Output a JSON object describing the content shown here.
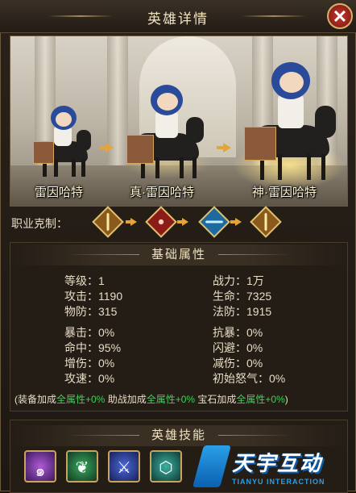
{
  "dialog": {
    "title": "英雄详情",
    "close_icon": "close-icon"
  },
  "heroes": [
    {
      "name": "雷因哈特",
      "icon": "hero-rider-sprite"
    },
    {
      "name": "真·雷因哈特",
      "icon": "hero-rider-sprite"
    },
    {
      "name": "神·雷因哈特",
      "icon": "hero-rider-sprite"
    }
  ],
  "counter": {
    "label": "职业克制：",
    "icons": [
      "warrior-sword-icon",
      "assassin-blade-icon",
      "mage-staff-icon",
      "warrior-sword-icon"
    ]
  },
  "basic": {
    "heading": "基础属性",
    "left": [
      "等级：1",
      "攻击：1190",
      "物防：315",
      "暴击：0%",
      "命中：95%",
      "增伤：0%",
      "攻速：0%"
    ],
    "right": [
      "战力：1万",
      "生命：7325",
      "法防：1915",
      "抗暴：0%",
      "闪避：0%",
      "减伤：0%",
      "初始怒气：0%"
    ],
    "bonus": {
      "open": "(装备加成",
      "equip_green": "全属性+0%",
      "help": " 助战加成",
      "help_green": "全属性+0%",
      "gem": " 宝石加成",
      "gem_green": "全属性+0%",
      "close": ")"
    }
  },
  "skills": {
    "heading": "英雄技能",
    "icons": [
      "vortex-skill-icon",
      "laurel-skill-icon",
      "slash-skill-icon",
      "shield-skill-icon"
    ]
  },
  "watermark": {
    "title": "天宇互动",
    "subtitle": "TIANYU INTERACTION"
  },
  "colors": {
    "accent_gold": "#e3a53a",
    "bonus_green": "#3ed05a",
    "close_red": "#c43a2e"
  }
}
